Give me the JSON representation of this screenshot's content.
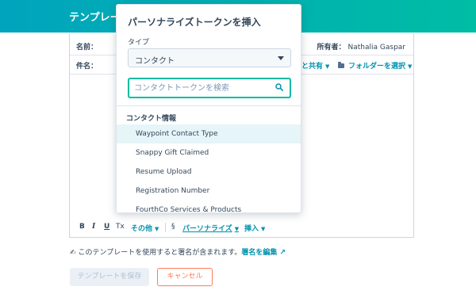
{
  "header": {
    "title": "テンプレー"
  },
  "editor": {
    "name_label": "名前：",
    "subject_label": "件名：",
    "owner_label": "所有者：",
    "owner_value": "Nathalia Gaspar",
    "share_label": "と共有",
    "folder_label": "フォルダーを選択",
    "toolbar": {
      "bold": "B",
      "italic": "I",
      "underline": "U",
      "clear_format": "Tx",
      "more": "その他",
      "personalize": "パーソナライズ",
      "insert": "挿入"
    }
  },
  "notice": {
    "text": "このテンプレートを使用すると署名が含まれます。",
    "link": "署名を編集"
  },
  "buttons": {
    "save": "テンプレートを保存",
    "cancel": "キャンセル"
  },
  "popover": {
    "title": "パーソナライズトークンを挿入",
    "type_label": "タイプ",
    "type_value": "コンタクト",
    "search_placeholder": "コンタクトトークンを検索",
    "group_label": "コンタクト情報",
    "items": [
      {
        "label": "Waypoint Contact Type"
      },
      {
        "label": "Snappy Gift Claimed"
      },
      {
        "label": "Resume Upload"
      },
      {
        "label": "Registration Number"
      },
      {
        "label": "FourthCo Services & Products"
      }
    ]
  },
  "colors": {
    "header_start": "#00a4bd",
    "header_end": "#00bda5",
    "link": "#0091ae",
    "cancel": "#ff7a59",
    "active_item": "#e5f5f8"
  }
}
